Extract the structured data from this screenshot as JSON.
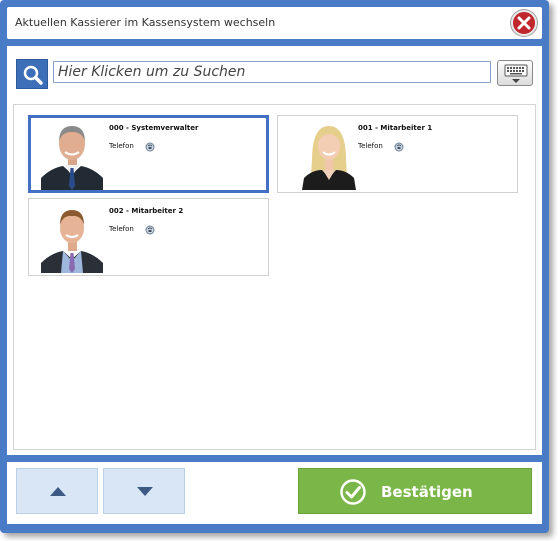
{
  "dialog": {
    "title": "Aktuellen Kassierer im Kassensystem wechseln"
  },
  "search": {
    "placeholder": "Hier Klicken um zu Suchen",
    "value": ""
  },
  "cashiers": [
    {
      "name": "000 -  Systemverwalter",
      "phone_label": "Telefon",
      "selected": true
    },
    {
      "name": "001 -  Mitarbeiter 1",
      "phone_label": "Telefon",
      "selected": false
    },
    {
      "name": "002 -  Mitarbeiter 2",
      "phone_label": "Telefon",
      "selected": false
    }
  ],
  "buttons": {
    "confirm_label": "Bestätigen"
  },
  "colors": {
    "frame": "#4a7bc6",
    "selected_border": "#4470c4",
    "confirm": "#7ab648",
    "nav_button": "#d8e6f6",
    "close": "#c0262b"
  },
  "icons": {
    "close": "close-icon",
    "search": "search-icon",
    "keyboard": "keyboard-icon",
    "phone": "phone-icon",
    "up": "arrow-up-icon",
    "down": "arrow-down-icon",
    "confirm": "checkmark-icon"
  }
}
